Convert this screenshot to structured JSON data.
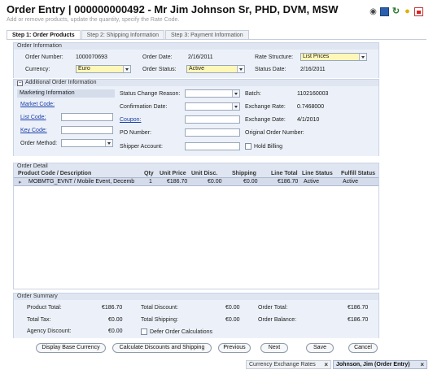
{
  "header": {
    "title": "Order Entry | 000000000492 - Mr Jim Johnson Sr, PHD, DVM, MSW",
    "subtitle": "Add or remove products, update the quantity, specify the Rate Code."
  },
  "toolbar_icons": [
    "eye-icon",
    "save-icon",
    "refresh-icon",
    "lightbulb-icon",
    "pdf-icon"
  ],
  "tabs": [
    {
      "label": "Step 1: Order Products",
      "active": true
    },
    {
      "label": "Step 2: Shipping Information",
      "active": false
    },
    {
      "label": "Step 3: Payment Information",
      "active": false
    }
  ],
  "order_information": {
    "heading": "Order Information",
    "order_number_label": "Order Number:",
    "order_number": "1000070693",
    "order_date_label": "Order Date:",
    "order_date": "2/16/2011",
    "rate_structure_label": "Rate Structure:",
    "rate_structure": "List Prices",
    "currency_label": "Currency:",
    "currency": "Euro",
    "order_status_label": "Order Status:",
    "order_status": "Active",
    "status_date_label": "Status Date:",
    "status_date": "2/16/2011"
  },
  "additional_information": {
    "heading": "Additional Order Information",
    "marketing_information": "Marketing Information",
    "market_code_label": "Market Code:",
    "list_code_label": "List Code:",
    "key_code_label": "Key Code:",
    "order_method_label": "Order Method:",
    "status_change_reason_label": "Status Change Reason:",
    "confirmation_date_label": "Confirmation Date:",
    "coupon_label": "Coupon:",
    "po_number_label": "PO Number:",
    "shipper_account_label": "Shipper Account:",
    "batch_label": "Batch:",
    "batch": "1102160003",
    "exchange_rate_label": "Exchange Rate:",
    "exchange_rate": "0.7468000",
    "exchange_date_label": "Exchange Date:",
    "exchange_date": "4/1/2010",
    "original_order_number_label": "Original Order Number:",
    "hold_billing_label": "Hold Billing"
  },
  "order_detail": {
    "heading": "Order Detail",
    "columns": [
      "Product Code / Description",
      "Qty",
      "Unit Price",
      "Unit Disc.",
      "Shipping",
      "Line Total",
      "Line Status",
      "Fulfill Status"
    ],
    "rows": [
      [
        "MOBMTG_EVNT / Mobile Event, Decemb",
        "1",
        "€186.70",
        "€0.00",
        "€0.00",
        "€186.70",
        "Active",
        "Active"
      ]
    ]
  },
  "order_summary": {
    "heading": "Order Summary",
    "product_total_label": "Product Total:",
    "product_total": "€186.70",
    "total_tax_label": "Total Tax:",
    "total_tax": "€0.00",
    "agency_discount_label": "Agency Discount:",
    "agency_discount": "€0.00",
    "total_discount_label": "Total Discount:",
    "total_discount": "€0.00",
    "total_shipping_label": "Total Shipping:",
    "total_shipping": "€0.00",
    "defer_label": "Defer Order Calculations",
    "order_total_label": "Order Total:",
    "order_total": "€186.70",
    "order_balance_label": "Order Balance:",
    "order_balance": "€186.70"
  },
  "buttons": {
    "display_base_currency": "Display Base Currency",
    "calculate": "Calculate Discounts and Shipping",
    "previous": "Previous",
    "next": "Next",
    "save": "Save",
    "cancel": "Cancel"
  },
  "bottom_tabs": [
    {
      "label": "Currency Exchange Rates",
      "active": false
    },
    {
      "label": "Johnson, Jim (Order Entry)",
      "active": true
    }
  ]
}
